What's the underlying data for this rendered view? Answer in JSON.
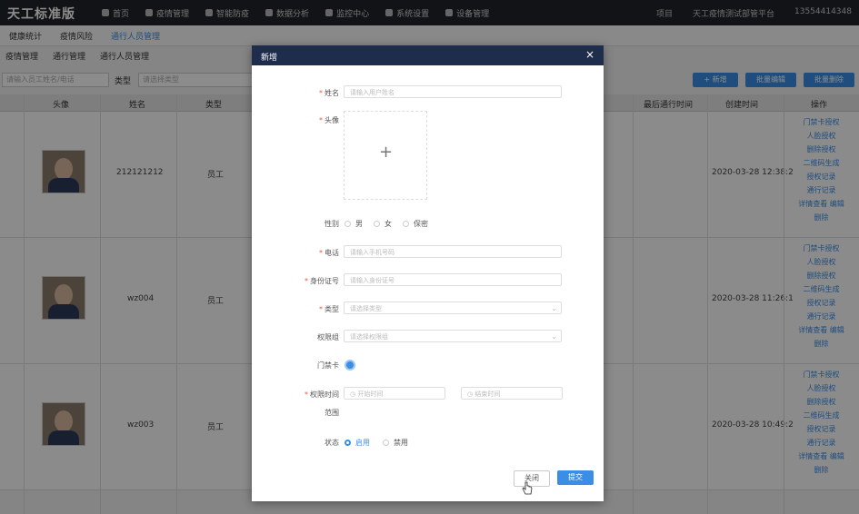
{
  "app": {
    "brand": "天工标准版"
  },
  "nav": [
    {
      "label": "首页"
    },
    {
      "label": "疫情管理"
    },
    {
      "label": "智能防疫"
    },
    {
      "label": "数据分析"
    },
    {
      "label": "监控中心"
    },
    {
      "label": "系统设置"
    },
    {
      "label": "设备管理"
    }
  ],
  "topright": {
    "project_label": "项目",
    "org": "天工疫情测试部管平台",
    "phone": "13554414348"
  },
  "breadcrumbs": [
    "健康统计",
    "疫情风险",
    "通行人员管理"
  ],
  "subtabs": [
    "疫情管理",
    "通行管理",
    "通行人员管理"
  ],
  "filters": {
    "search_placeholder": "请输入员工姓名/电话",
    "type_label": "类型",
    "type_placeholder": "请选择类型"
  },
  "actions": {
    "add": "+ 新增",
    "batch_edit": "批量编辑",
    "batch_delete": "批量删除"
  },
  "table": {
    "headers": [
      "头像",
      "姓名",
      "类型",
      "最后通行时间",
      "创建时间",
      "操作"
    ],
    "rows": [
      {
        "name": "212121212",
        "type": "员工",
        "created": "2020-03-28 12:38:2"
      },
      {
        "name": "wz004",
        "type": "员工",
        "created": "2020-03-28 11:26:1"
      },
      {
        "name": "wz003",
        "type": "员工",
        "created": "2020-03-28 10:49:2"
      }
    ],
    "ops": [
      "门禁卡授权",
      "人脸授权",
      "删除授权",
      "二维码生成",
      "授权记录",
      "通行记录",
      "详情查看",
      "编辑",
      "删除"
    ]
  },
  "modal": {
    "title": "新增",
    "close": "×",
    "fields": {
      "name_label": "姓名",
      "name_placeholder": "请输入用户姓名",
      "avatar_label": "头像",
      "gender_label": "性别",
      "gender_options": [
        "男",
        "女",
        "保密"
      ],
      "phone_label": "电话",
      "phone_placeholder": "请输入手机号码",
      "id_label": "身份证号",
      "id_placeholder": "请输入身份证号",
      "type_label": "类型",
      "type_placeholder": "请选择类型",
      "perm_label": "权限组",
      "perm_placeholder": "请选择权限组",
      "card_label": "门禁卡",
      "range_label": "权限时间",
      "range_label2": "范围",
      "start_placeholder": "开始时间",
      "end_placeholder": "结束时间",
      "status_label": "状态",
      "status_options": [
        "启用",
        "禁用"
      ]
    },
    "buttons": {
      "cancel": "关闭",
      "submit": "提交"
    }
  },
  "colors": {
    "primary": "#3a8ee6",
    "header": "#1f2d4d",
    "topbar": "#1f2329"
  }
}
